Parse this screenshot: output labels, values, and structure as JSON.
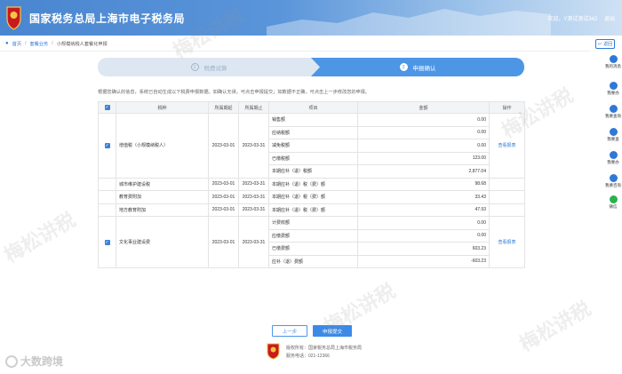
{
  "header": {
    "title": "国家税务总局上海市电子税务局",
    "user_label": "欢迎，Y测试测试342",
    "exit_label": "退出"
  },
  "breadcrumb": {
    "home": "首页",
    "level1": "套餐业务",
    "level2": "小规模纳税人套餐化申报"
  },
  "back_label": "返回",
  "rail": [
    {
      "label": "我的消息"
    },
    {
      "label": "我要办"
    },
    {
      "label": "我要查询"
    },
    {
      "label": "我要查"
    },
    {
      "label": "我要办"
    },
    {
      "label": "我要咨询"
    },
    {
      "label": "微信"
    }
  ],
  "steps": [
    {
      "num": "1",
      "label": "税费试算"
    },
    {
      "num": "2",
      "label": "申报确认"
    }
  ],
  "notice": "根据您确认的信息，系统已自动生成以下税费申报数据。如确认无误，可点击申报提交；如数据不正确，可点击上一步修改您的申报。",
  "table": {
    "headers": {
      "check": "✓",
      "tax": "税种",
      "start": "所属期起",
      "end": "所属期止",
      "item": "项目",
      "amount": "金额",
      "op": "操作"
    },
    "vat": {
      "name": "增值税（小规模纳税人）",
      "start": "2023-03-01",
      "end": "2023-03-31",
      "op": "查看报表",
      "rows": [
        {
          "item": "销售额",
          "amount": "0.00"
        },
        {
          "item": "应纳税额",
          "amount": "0.00"
        },
        {
          "item": "减免税额",
          "amount": "0.00"
        },
        {
          "item": "已缴税额",
          "amount": "123.00"
        },
        {
          "item": "本期应补（退）税额",
          "amount": "2,877.04"
        }
      ]
    },
    "surtax": [
      {
        "name": "城市维护建设税",
        "start": "2023-03-01",
        "end": "2023-03-31",
        "item": "本期应补（退）税（费）额",
        "amount": "98.68"
      },
      {
        "name": "教育费附加",
        "start": "2023-03-01",
        "end": "2023-03-31",
        "item": "本期应补（退）税（费）额",
        "amount": "33.43"
      },
      {
        "name": "地方教育附加",
        "start": "2023-03-01",
        "end": "2023-03-31",
        "item": "本期应补（退）税（费）额",
        "amount": "47.93"
      }
    ],
    "culture": {
      "name": "文化事业建设费",
      "start": "2023-03-01",
      "end": "2023-03-31",
      "op": "查看报表",
      "rows": [
        {
          "item": "计费收额",
          "amount": "0.00"
        },
        {
          "item": "应缴费额",
          "amount": "0.00"
        },
        {
          "item": "已缴费额",
          "amount": "603.23"
        },
        {
          "item": "应补（退）费额",
          "amount": "-603.23"
        }
      ]
    }
  },
  "buttons": {
    "prev": "上一步",
    "submit": "申报提交"
  },
  "footer": {
    "line1": "版权所有：国家税务总局上海市税务局",
    "line2": "服务电话：021-12366"
  },
  "watermark": "梅松讲税",
  "corner_logo": "大数跨境",
  "colors": {
    "primary": "#3c8ae6",
    "header": "#4a86d0"
  }
}
